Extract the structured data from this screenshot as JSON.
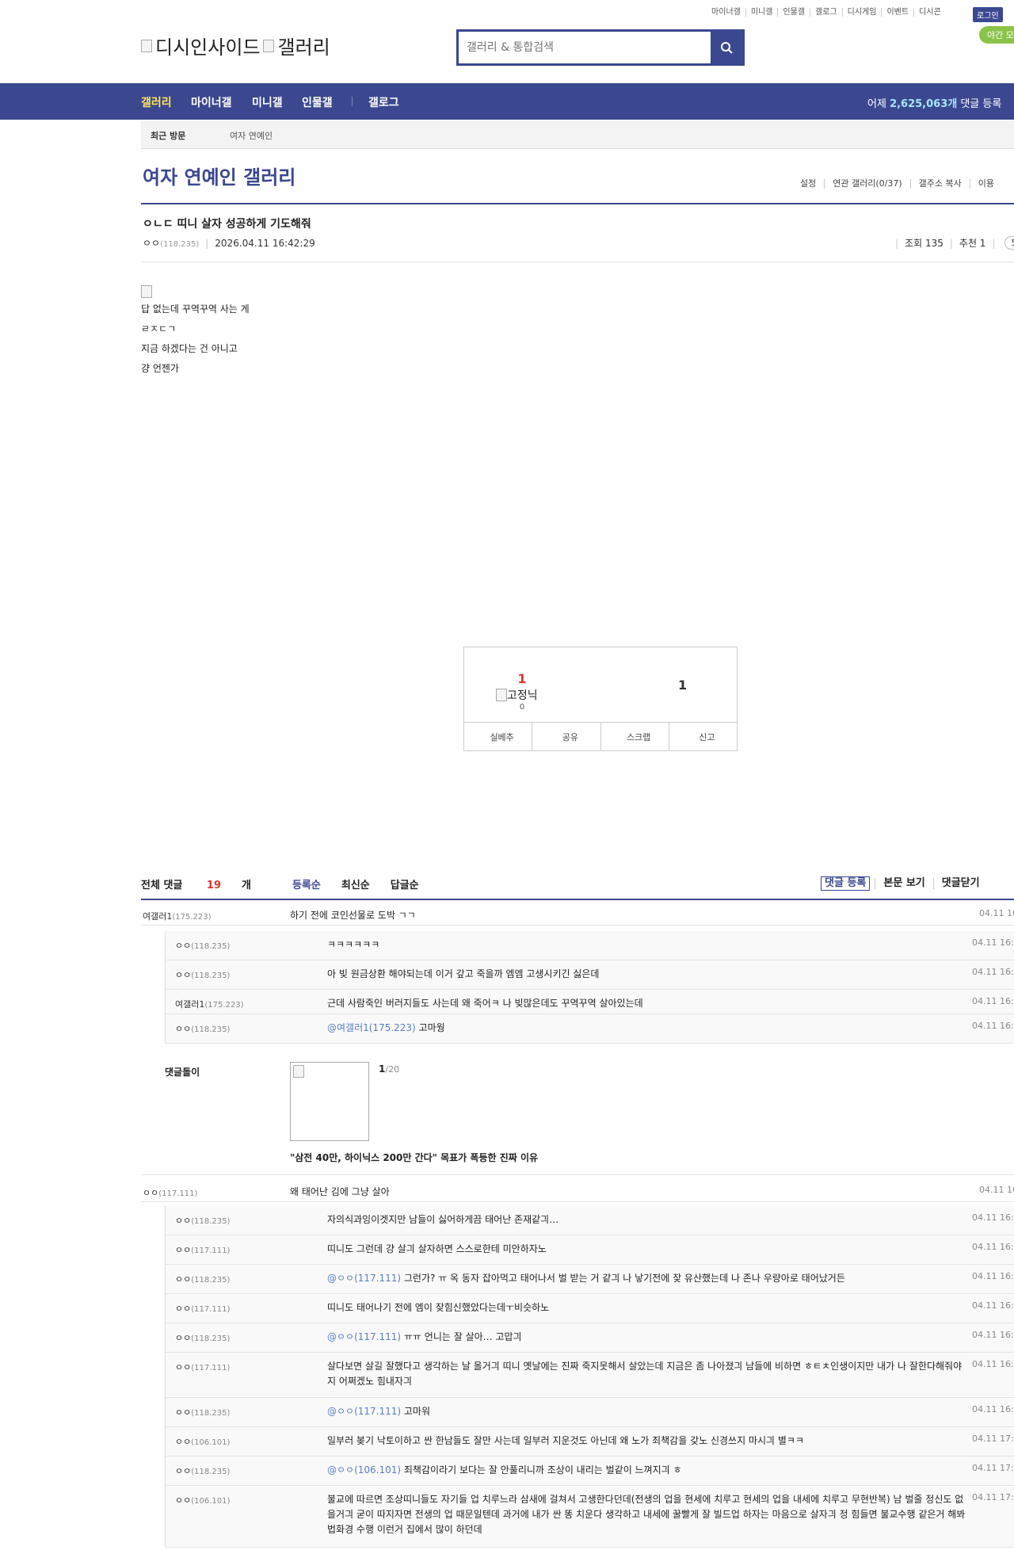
{
  "header": {
    "top_links": [
      "마이너갤",
      "미니갤",
      "인물갤",
      "갤로그",
      "디시게임",
      "이벤트",
      "디시콘"
    ],
    "login": "로그인",
    "night_mode": "야간 모",
    "logo_left": "디시인사이드",
    "logo_right": "갤러리",
    "search_placeholder": "갤러리 & 통합검색"
  },
  "nav": {
    "items": [
      "갤러리",
      "마이너갤",
      "미니갤",
      "인물갤",
      "갤로그"
    ],
    "active_color": "#ffe359",
    "right_prefix": "어제 ",
    "right_count": "2,625,063개",
    "right_suffix": " 댓글 등록"
  },
  "visit": {
    "label": "최근 방문",
    "item": "여자 연예인"
  },
  "gallery": {
    "title": "여자 연예인 갤러리",
    "options": [
      "설정",
      "연관 갤러리(0/37)",
      "갤주소 복사",
      "이용"
    ]
  },
  "post": {
    "title": "ㅇㄴㄷ 띠니 살자 성공하게 기도해줘",
    "author": "ㅇㅇ",
    "ip": "(118.235)",
    "date": "2026.04.11 16:42:29",
    "views": "조회 135",
    "recommend": "추천 1",
    "comment_count_pill": "5",
    "lines": [
      "답 없는데 꾸역꾸역 사는 게",
      "ㄹㅈㄷㄱ",
      "지금 하겠다는 건 아니고",
      "걍 언젠가"
    ]
  },
  "recommend_box": {
    "up": "1",
    "image_alt": "고정닉",
    "fixed_count": "0",
    "down": "1",
    "buttons": [
      "실베추",
      "공유",
      "스크랩",
      "신고"
    ]
  },
  "comments_header": {
    "total_label": "전체 댓글 ",
    "total_count": "19",
    "total_unit": "개",
    "sort": [
      "등록순",
      "최신순",
      "답글순"
    ],
    "actions": [
      "댓글 등록",
      "본문 보기",
      "댓글닫기"
    ]
  },
  "comments": [
    {
      "nick": "여갤러1",
      "ip": "(175.223)",
      "text": "하기 전에 코인선물로 도박 ㄱㄱ",
      "mention": "",
      "date": "04.11 16"
    },
    {
      "nick": "ㅇㅇ",
      "ip": "(118.235)",
      "text": "ㅋㅋㅋㅋㅋㅋ",
      "mention": "",
      "date": "04.11 16:4"
    },
    {
      "nick": "ㅇㅇ",
      "ip": "(118.235)",
      "text": "아 빚 원금상환 해야되는데 이거 갚고 죽을까 엠엠 고생시키긴 싫은데",
      "mention": "",
      "date": "04.11 16:4"
    },
    {
      "nick": "여갤러1",
      "ip": "(175.223)",
      "text": "근데 사람죽인 버러지들도 사는데 왜 죽어ㅋ 나 빚많은데도 꾸역꾸역 살아있는데",
      "mention": "",
      "date": "04.11 16:4"
    },
    {
      "nick": "ㅇㅇ",
      "ip": "(118.235)",
      "text": " 고마웡",
      "mention": "@여갤러1(175.223)",
      "date": "04.11 16:5"
    },
    {
      "nick": "ㅇㅇ",
      "ip": "(117.111)",
      "text": "왜 태어난 김에 그냥 살아",
      "mention": "",
      "date": "04.11 16"
    },
    {
      "nick": "ㅇㅇ",
      "ip": "(118.235)",
      "text": "자의식과잉이겟지만 남들이 싫어하게끔 태어난 존재같긔…",
      "mention": "",
      "date": "04.11 16:4"
    },
    {
      "nick": "ㅇㅇ",
      "ip": "(117.111)",
      "text": "띠니도 그런데 걍 살긔 살자하면 스스로한테 미안하자노",
      "mention": "",
      "date": "04.11 16:4"
    },
    {
      "nick": "ㅇㅇ",
      "ip": "(118.235)",
      "text": " 그런가? ㅠ 옥 동자 잡아먹고 태어나서 벌 받는 거 같긔 나 낳기전에 잦 유산했는데 나 존나 우량아로 태어났거든",
      "mention": "@ㅇㅇ(117.111)",
      "date": "04.11 16:4"
    },
    {
      "nick": "ㅇㅇ",
      "ip": "(117.111)",
      "text": "띠니도 태어나기 전에 엠이 잦힘신했았다는데ㅜ비슷하노",
      "mention": "",
      "date": "04.11 16:4"
    },
    {
      "nick": "ㅇㅇ",
      "ip": "(118.235)",
      "text": " ㅠㅠ 언니는 잘 살아… 고맙긔",
      "mention": "@ㅇㅇ(117.111)",
      "date": "04.11 16:4"
    },
    {
      "nick": "ㅇㅇ",
      "ip": "(117.111)",
      "text": "살다보면 살길 잘했다고 생각하는 날 올거긔 띠니 옛날에는 진짜 죽지못해서 살았는데 지금은 좀 나아졌긔 남들에 비하면 ㅎㅌㅊ인생이지만 내가 나 잘한다해줘야지 어쩌겠노 힘내자긔",
      "mention": "",
      "date": "04.11 16:5"
    },
    {
      "nick": "ㅇㅇ",
      "ip": "(118.235)",
      "text": " 고마워",
      "mention": "@ㅇㅇ(117.111)",
      "date": "04.11 16:5"
    },
    {
      "nick": "ㅇㅇ",
      "ip": "(106.101)",
      "text": "일부러 봊기 낙토이하고 싼 한남들도 잘만 사는데 일부러 지운것도 아닌데 왜 노가 죄책감을 갖노 신경쓰지 마시긔 별ㅋㅋ",
      "mention": "",
      "date": "04.11 17:1"
    },
    {
      "nick": "ㅇㅇ",
      "ip": "(118.235)",
      "text": " 죄책감이라기 보다는 잘 안풀리니까 조상이 내리는 벌같이 느껴지긔 ㅎ",
      "mention": "@ㅇㅇ(106.101)",
      "date": "04.11 17:2"
    },
    {
      "nick": "ㅇㅇ",
      "ip": "(106.101)",
      "text": "불교에 따르면 조상띠니들도 자기들 업 치루느라 삼새에 걸쳐서 고생한다던데(전생의 업을 현세에 치루고 현세의 업을 내세에 치루고 무현반복) 남 벌줄 정신도 없을거긔 굳이 따지자면 전생의 업 때문일텐데 과거에 내가 싼 똥 치운다 생각하고 내세에 꿀빨게 잘 빌드업 하자는 마음으로 살자긔 정 힘들면 불교수행 같은거 해봐 법화경 수행 이런거 집에서 많이 하던데",
      "mention": "",
      "date": "04.11 17:2"
    }
  ],
  "ad": {
    "label": "댓글돌이",
    "current": "1",
    "total": "/20",
    "title": "\"삼전 40만, 하이닉스 200만 간다\" 목표가 폭등한 진짜 이유"
  }
}
